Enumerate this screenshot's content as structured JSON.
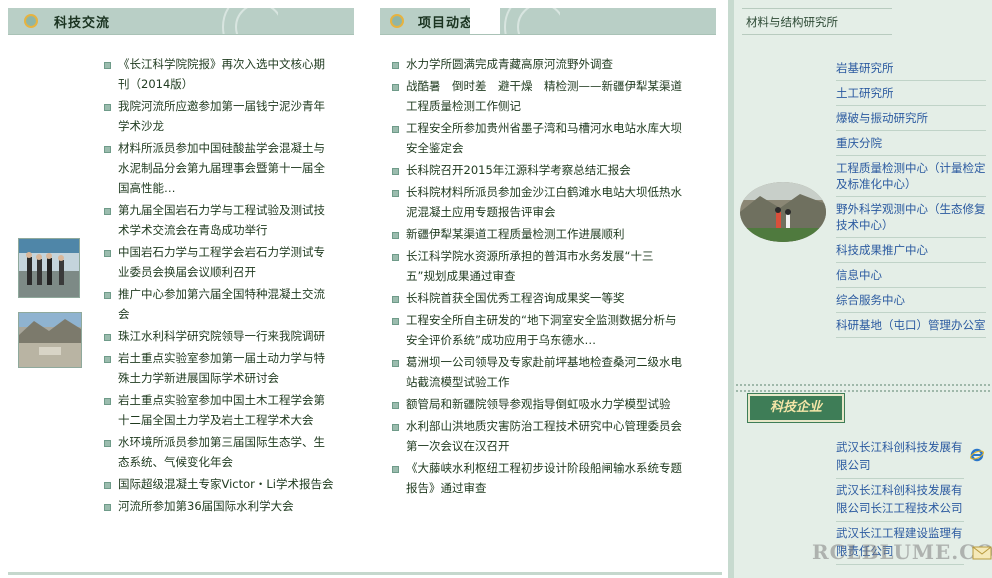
{
  "left_section": {
    "title": "科技交流",
    "items": [
      "《长江科学院院报》再次入选中文核心期刊（2014版）",
      "我院河流所应邀参加第一届钱宁泥沙青年学术沙龙",
      "材料所派员参加中国硅酸盐学会混凝土与水泥制品分会第九届理事会暨第十一届全国高性能…",
      "第九届全国岩石力学与工程试验及测试技术学术交流会在青岛成功举行",
      "中国岩石力学与工程学会岩石力学测试专业委员会换届会议顺利召开",
      "推广中心参加第六届全国特种混凝土交流会",
      "珠江水利科学研究院领导一行来我院调研",
      "岩土重点实验室参加第一届土动力学与特殊土力学新进展国际学术研讨会",
      "岩土重点实验室参加中国土木工程学会第十二届全国土力学及岩土工程学术大会",
      "水环境所派员参加第三届国际生态学、生态系统、气候变化年会",
      "国际超级混凝土专家Victor・Li学术报告会",
      "河流所参加第36届国际水利学大会"
    ]
  },
  "middle_section": {
    "title": "项目动态",
    "items": [
      "水力学所圆满完成青藏高原河流野外调查",
      "战酷暑　倒时差　避干燥　精检测——新疆伊犁某渠道工程质量检测工作侧记",
      "工程安全所参加贵州省墨子湾和马槽河水电站水库大坝安全鉴定会",
      "长科院召开2015年江源科学考察总结汇报会",
      "长科院材料所派员参加金沙江白鹤滩水电站大坝低热水泥混凝土应用专题报告评审会",
      "新疆伊犁某渠道工程质量检测工作进展顺利",
      "长江科学院水资源所承担的普洱市水务发展“十三五”规划成果通过审查",
      "长科院首获全国优秀工程咨询成果奖一等奖",
      "工程安全所自主研发的“地下洞室安全监测数据分析与安全评价系统”成功应用于乌东德水…",
      "葛洲坝一公司领导及专家赴前坪基地检查桑河二级水电站截流模型试验工作",
      "额管局和新疆院领导参观指导倒虹吸水力学模型试验",
      "水利部山洪地质灾害防治工程技术研究中心管理委员会第一次会议在汉召开",
      "《大藤峡水利枢纽工程初步设计阶段船闸输水系统专题报告》通过审查"
    ]
  },
  "right_column": {
    "top_link": "材料与结构研究所",
    "institutes": [
      "岩基研究所",
      "土工研究所",
      "爆破与振动研究所",
      "重庆分院",
      "工程质量检测中心（计量检定及标准化中心）",
      "野外科学观测中心（生态修复技术中心）",
      "科技成果推广中心",
      "信息中心",
      "综合服务中心",
      "科研基地（屯口）管理办公室"
    ],
    "enterprise_tab": "科技企业",
    "enterprises": [
      "武汉长江科创科技发展有限公司",
      "武汉长江科创科技发展有限公司长江工程技术公司",
      "武汉长江工程建设监理有限责任公司"
    ],
    "watermark": "RCLBLUME.COM"
  },
  "icons": {
    "section_ring": "ring-icon",
    "list_bullet": "square-bullet-icon",
    "ie": "ie-browser-icon",
    "mail": "envelope-icon"
  },
  "colors": {
    "header_bg": "#b9cfc6",
    "right_bg": "#e4eee7",
    "link_blue": "#2b5aa0",
    "tab_green": "#3e7d57"
  }
}
